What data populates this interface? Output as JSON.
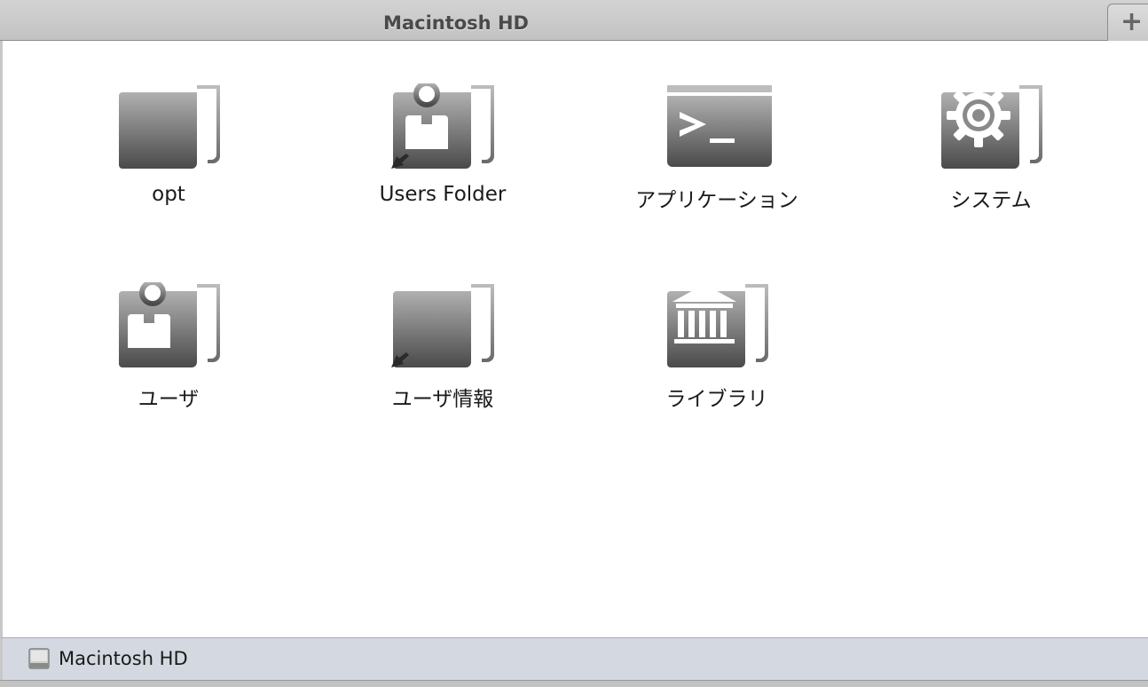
{
  "window": {
    "tab_title": "Macintosh HD",
    "new_tab_symbol": "+"
  },
  "items": [
    {
      "label": "opt",
      "icon": "folder-icon"
    },
    {
      "label": "Users Folder",
      "icon": "users-folder-alias-icon"
    },
    {
      "label": "アプリケーション",
      "icon": "applications-terminal-folder-icon"
    },
    {
      "label": "システム",
      "icon": "system-gear-folder-icon"
    },
    {
      "label": "ユーザ",
      "icon": "users-folder-icon"
    },
    {
      "label": "ユーザ情報",
      "icon": "folder-alias-icon"
    },
    {
      "label": "ライブラリ",
      "icon": "library-folder-icon"
    }
  ],
  "pathbar": {
    "label": "Macintosh HD",
    "icon": "hard-disk-icon"
  },
  "colors": {
    "tabbar": "#c8c8c8",
    "pathbar": "#d4d9e1",
    "icon_dark": "#4d4d4d",
    "icon_light": "#aaaaaa"
  }
}
